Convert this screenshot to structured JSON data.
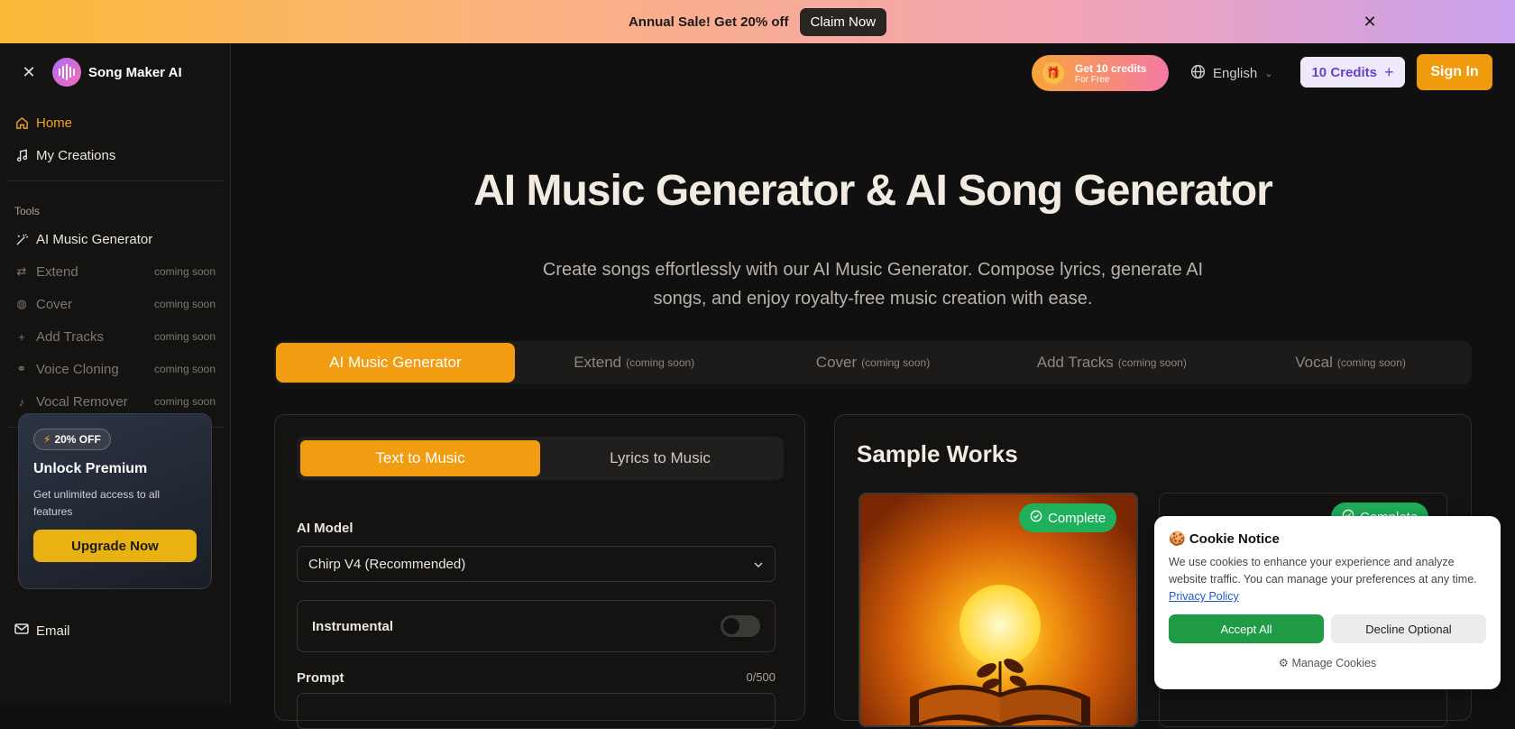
{
  "banner": {
    "text": "Annual Sale! Get 20% off",
    "cta": "Claim Now",
    "close": "✕"
  },
  "sidebar": {
    "brand": "Song Maker AI",
    "close": "✕",
    "nav": [
      {
        "label": "Home",
        "icon": "home-icon"
      },
      {
        "label": "My Creations",
        "icon": "music-note-icon"
      }
    ],
    "tools_label": "Tools",
    "tools": [
      {
        "label": "AI Music Generator",
        "soon": ""
      },
      {
        "label": "Extend",
        "soon": "coming soon"
      },
      {
        "label": "Cover",
        "soon": "coming soon"
      },
      {
        "label": "Add Tracks",
        "soon": "coming soon"
      },
      {
        "label": "Voice Cloning",
        "soon": "coming soon"
      },
      {
        "label": "Vocal Remover",
        "soon": "coming soon"
      }
    ],
    "promo": {
      "badge": "20% OFF",
      "title": "Unlock Premium",
      "desc": "Get unlimited access to all features",
      "button": "Upgrade Now"
    },
    "email": "Email"
  },
  "topbar": {
    "credits_promo": {
      "line1": "Get 10 credits",
      "line2": "For Free"
    },
    "language": "English",
    "credits": "10 Credits",
    "signin": "Sign In"
  },
  "hero": {
    "title": "AI Music Generator & AI Song Generator",
    "subtitle": "Create songs effortlessly with our AI Music Generator. Compose lyrics, generate AI songs, and enjoy royalty-free music creation with ease."
  },
  "tabs": [
    {
      "label": "AI Music Generator",
      "note": ""
    },
    {
      "label": "Extend",
      "note": "(coming soon)"
    },
    {
      "label": "Cover",
      "note": "(coming soon)"
    },
    {
      "label": "Add Tracks",
      "note": "(coming soon)"
    },
    {
      "label": "Vocal",
      "note": "(coming soon)"
    }
  ],
  "form": {
    "modes": [
      "Text to Music",
      "Lyrics to Music"
    ],
    "model_label": "AI Model",
    "model_value": "Chirp V4 (Recommended)",
    "instrumental_label": "Instrumental",
    "prompt_label": "Prompt",
    "prompt_counter": "0/500"
  },
  "samples": {
    "title": "Sample Works",
    "badge": "Complete"
  },
  "cookie": {
    "title": "🍪 Cookie Notice",
    "text": "We use cookies to enhance your experience and analyze website traffic. You can manage your preferences at any time.",
    "link": "Privacy Policy",
    "accept": "Accept All",
    "decline": "Decline Optional",
    "manage": "Manage Cookies"
  },
  "colors": {
    "accent": "#f29c11",
    "success": "#1fb05c",
    "credits": "#6a3fd3"
  }
}
